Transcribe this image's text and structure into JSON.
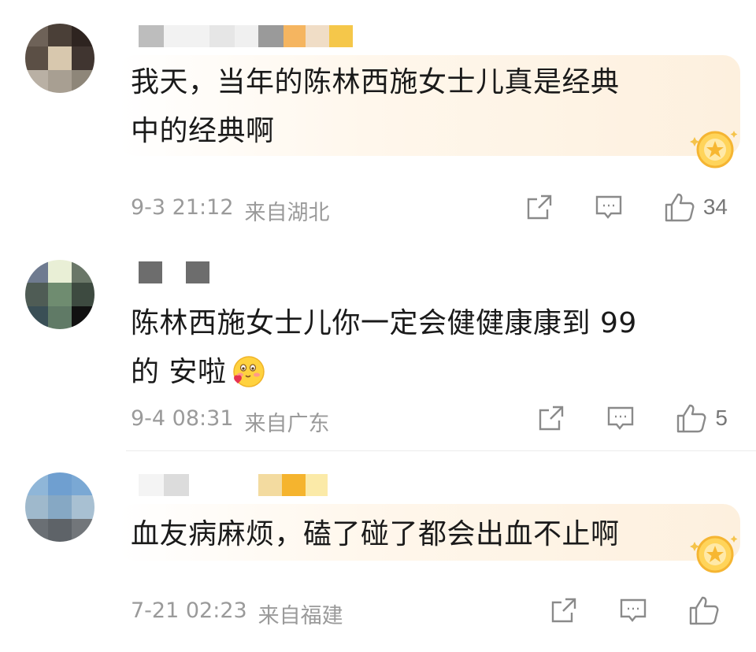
{
  "comments": [
    {
      "text_line1": "我天，当年的陈林西施女士儿真是经典",
      "text_line2": "中的经典啊",
      "date": "9-3 21:12",
      "location": "来自湖北",
      "likes": "34",
      "badge_icon": "gold-star-badge-icon"
    },
    {
      "text_line1": "陈林西施女士儿你一定会健健康康到 99",
      "text_line2": "的 安啦",
      "date": "9-4 08:31",
      "location": "来自广东",
      "likes": "5",
      "emoji_icon": "blushing-heart-emoji-icon"
    },
    {
      "text_line1": "血友病麻烦，磕了碰了都会出血不止啊",
      "date": "7-21 02:23",
      "location": "来自福建",
      "likes": "",
      "badge_icon": "gold-star-badge-icon"
    }
  ],
  "icons": {
    "share": "share-icon",
    "reply": "comment-icon",
    "like": "thumbs-up-icon"
  }
}
